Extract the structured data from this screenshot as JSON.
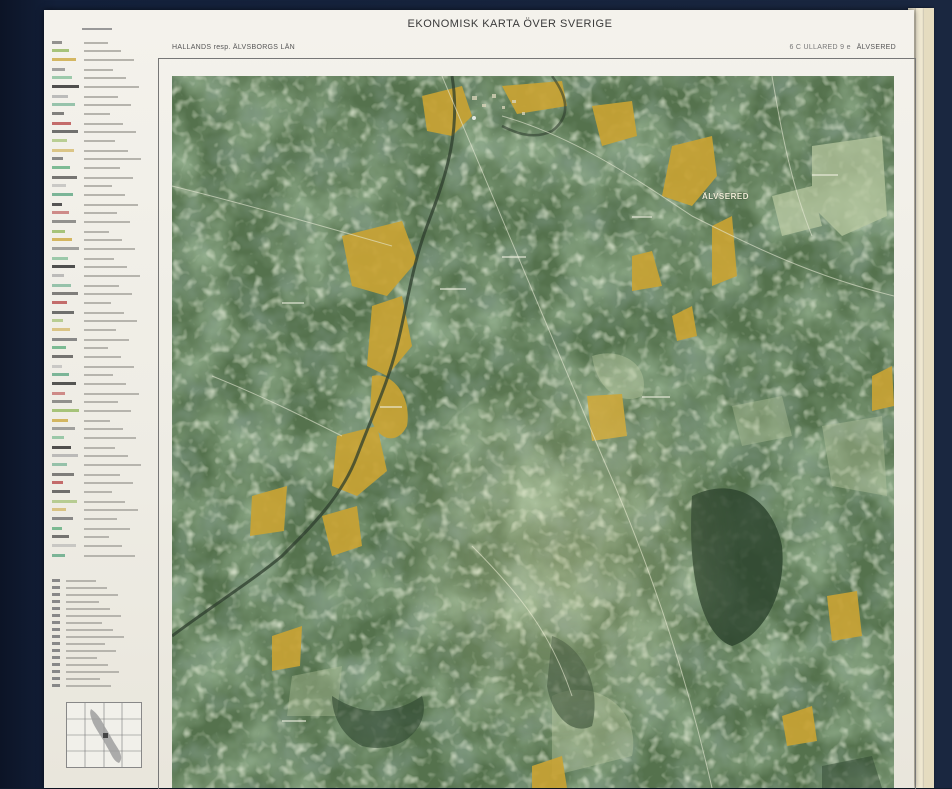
{
  "sheet": {
    "series_title": "EKONOMISK KARTA ÖVER SVERIGE",
    "county": "HALLANDS resp. ÄLVSBORGS LÄN",
    "sheet_code": "6 C ULLARED 9 e",
    "sheet_name": "ÄLVSERED"
  },
  "map": {
    "place_labels": [
      "ÄLVSERED"
    ]
  },
  "colors": {
    "forest": "#4f6d48",
    "forest_dark": "#3c5639",
    "open_land": "#9fb58a",
    "farmland": "#c9a334",
    "paper": "#f1efe8",
    "backdrop": "#13203a"
  },
  "icons": {
    "index_map": "index-map-icon"
  }
}
